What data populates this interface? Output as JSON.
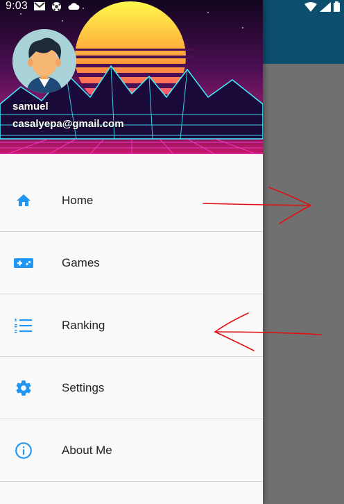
{
  "status_bar": {
    "time": "9:03"
  },
  "drawer": {
    "user": {
      "name": "samuel",
      "email": "casalyepa@gmail.com"
    },
    "menu": [
      {
        "label": "Home",
        "icon": "home-icon"
      },
      {
        "label": "Games",
        "icon": "gamepad-icon"
      },
      {
        "label": "Ranking",
        "icon": "list-icon"
      },
      {
        "label": "Settings",
        "icon": "gear-icon"
      },
      {
        "label": "About Me",
        "icon": "info-icon"
      }
    ]
  },
  "colors": {
    "accent": "#2196f3",
    "appbar": "#0d4d6e",
    "scrim": "#707070",
    "annotation": "#e01010"
  }
}
